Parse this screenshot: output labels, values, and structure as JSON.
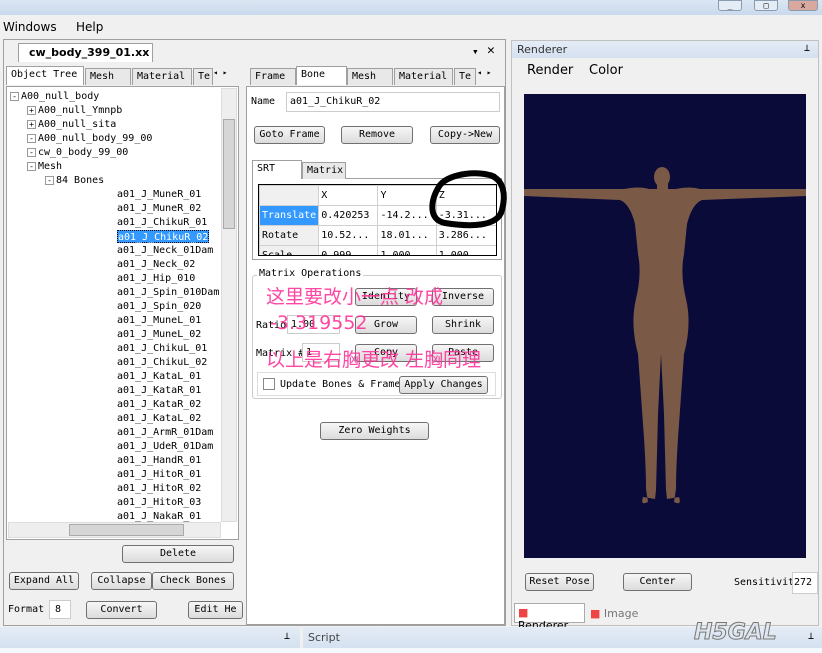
{
  "menu": [
    "Windows",
    "Help"
  ],
  "document_tab": "cw_body_399_01.xx",
  "left_tabs": [
    "Object Tree",
    "Mesh",
    "Material",
    "Te"
  ],
  "tree": [
    {
      "label": "A00_null_body",
      "level": 0,
      "exp": "-"
    },
    {
      "label": "A00_null_Ymnpb",
      "level": 1,
      "exp": "+"
    },
    {
      "label": "A00_null_sita",
      "level": 1,
      "exp": "+"
    },
    {
      "label": "A00_null_body_99_00",
      "level": 1,
      "exp": "-"
    },
    {
      "label": "cw_0_body_99_00",
      "level": 2,
      "exp": "-"
    },
    {
      "label": "Mesh",
      "level": 3,
      "exp": "-"
    },
    {
      "label": "84 Bones",
      "level": 4,
      "exp": "-"
    },
    {
      "label": "a01_J_MuneR_01",
      "level": 5
    },
    {
      "label": "a01_J_MuneR_02",
      "level": 5
    },
    {
      "label": "a01_J_ChikuR_01",
      "level": 5
    },
    {
      "label": "a01_J_ChikuR_02",
      "level": 5,
      "selected": true
    },
    {
      "label": "a01_J_Neck_01Dam",
      "level": 5
    },
    {
      "label": "a01_J_Neck_02",
      "level": 5
    },
    {
      "label": "a01_J_Hip_010",
      "level": 5
    },
    {
      "label": "a01_J_Spin_010Dam",
      "level": 5
    },
    {
      "label": "a01_J_Spin_020",
      "level": 5
    },
    {
      "label": "a01_J_MuneL_01",
      "level": 5
    },
    {
      "label": "a01_J_MuneL_02",
      "level": 5
    },
    {
      "label": "a01_J_ChikuL_01",
      "level": 5
    },
    {
      "label": "a01_J_ChikuL_02",
      "level": 5
    },
    {
      "label": "a01_J_KataL_01",
      "level": 5
    },
    {
      "label": "a01_J_KataR_01",
      "level": 5
    },
    {
      "label": "a01_J_KataR_02",
      "level": 5
    },
    {
      "label": "a01_J_KataL_02",
      "level": 5
    },
    {
      "label": "a01_J_ArmR_01Dam",
      "level": 5
    },
    {
      "label": "a01_J_UdeR_01Dam",
      "level": 5
    },
    {
      "label": "a01_J_HandR_01",
      "level": 5
    },
    {
      "label": "a01_J_HitoR_01",
      "level": 5
    },
    {
      "label": "a01_J_HitoR_02",
      "level": 5
    },
    {
      "label": "a01_J_HitoR_03",
      "level": 5
    },
    {
      "label": "a01_J_NakaR_01",
      "level": 5
    }
  ],
  "left_buttons": {
    "delete": "Delete",
    "expand_all": "Expand All",
    "collapse": "Collapse",
    "check_bones": "Check Bones",
    "format_label": "Format",
    "format_value": "8",
    "convert": "Convert",
    "edit_hex": "Edit He"
  },
  "mid_tabs": [
    "Frame",
    "Bone",
    "Mesh",
    "Material",
    "Te"
  ],
  "bone": {
    "name_label": "Name",
    "name_value": "a01_J_ChikuR_02",
    "goto_frame": "Goto Frame",
    "remove": "Remove",
    "copy_new": "Copy->New",
    "srt_tabs": [
      "SRT",
      "Matrix"
    ],
    "columns": [
      "",
      "X",
      "Y",
      "Z"
    ],
    "rows": [
      [
        "Translate",
        "0.420253",
        "-14.2...",
        "-3.31..."
      ],
      [
        "Rotate",
        "10.52...",
        "18.01...",
        "3.286..."
      ],
      [
        "Scale",
        "0.999",
        "1.000",
        "1.000"
      ]
    ],
    "matrix_ops": "Matrix Operations",
    "identity": "Identity",
    "inverse": "Inverse",
    "ratio_label": "Ratio",
    "ratio_value": "1.00",
    "grow": "Grow",
    "shrink": "Shrink",
    "matrix_label": "Matrix #",
    "matrix_value": "1",
    "copy": "Copy",
    "paste": "Paste",
    "update_bones": "Update Bones & Frame",
    "apply": "Apply Changes",
    "zero_weights": "Zero Weights"
  },
  "annotation": {
    "line1": "这里要改小一点 改成",
    "line2": "-3.319552",
    "line3": "以上是右胸更改 左胸同理"
  },
  "renderer": {
    "title": "Renderer",
    "menu": [
      "Render",
      "Color"
    ],
    "reset_pose": "Reset Pose",
    "center": "Center",
    "sensitivity_label": "Sensitivit",
    "sensitivity_value": "272",
    "tabs": [
      "Renderer",
      "Image"
    ],
    "bg": "#0b0b3a"
  },
  "bottom": {
    "script": "Script"
  },
  "watermark": "H5GAL"
}
